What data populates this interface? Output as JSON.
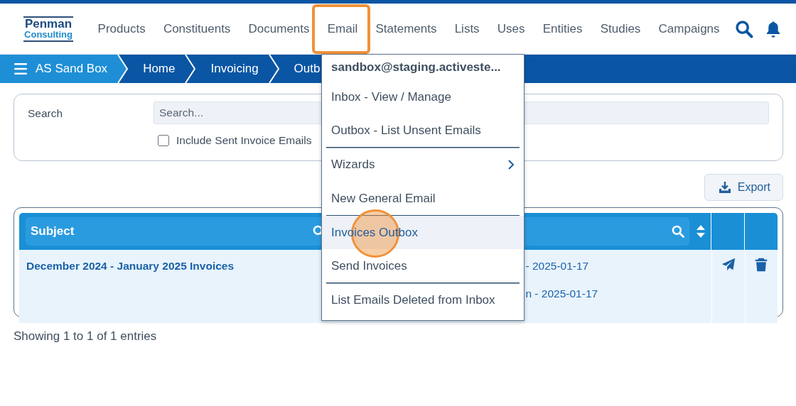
{
  "logo": {
    "line1": "Penman",
    "line2": "Consulting"
  },
  "nav": [
    {
      "label": "Products",
      "selected": false
    },
    {
      "label": "Constituents",
      "selected": false
    },
    {
      "label": "Documents",
      "selected": false
    },
    {
      "label": "Email",
      "selected": true
    },
    {
      "label": "Statements",
      "selected": false
    },
    {
      "label": "Lists",
      "selected": false
    },
    {
      "label": "Uses",
      "selected": false
    },
    {
      "label": "Entities",
      "selected": false
    },
    {
      "label": "Studies",
      "selected": false
    },
    {
      "label": "Campaigns",
      "selected": false
    }
  ],
  "breadcrumbs": [
    {
      "label": "AS Sand Box",
      "kind": "root"
    },
    {
      "label": "Home",
      "kind": "crumb"
    },
    {
      "label": "Invoicing",
      "kind": "crumb"
    },
    {
      "label": "Outb",
      "kind": "crumb"
    }
  ],
  "search": {
    "label": "Search",
    "placeholder": "Search...",
    "include_sent": {
      "label": "Include Sent Invoice Emails",
      "checked": false
    }
  },
  "export_button": "Export",
  "table": {
    "columns": [
      "Subject"
    ],
    "rows": [
      {
        "subject": "December 2024 - January 2025 Invoices",
        "column_2": [
          "- 2025-01-17",
          "n - 2025-01-17"
        ]
      }
    ]
  },
  "status": "Showing 1 to 1 of 1 entries",
  "menu": {
    "account": "sandbox@staging.activeste...",
    "items": [
      {
        "label": "Inbox - View / Manage",
        "selected": false,
        "submenu": false,
        "divider_after": false
      },
      {
        "label": "Outbox - List Unsent Emails",
        "selected": false,
        "submenu": false,
        "divider_after": true
      },
      {
        "label": "Wizards",
        "selected": false,
        "submenu": true,
        "divider_after": false
      },
      {
        "label": "New General Email",
        "selected": false,
        "submenu": false,
        "divider_after": true
      },
      {
        "label": "Invoices Outbox",
        "selected": true,
        "submenu": false,
        "divider_after": false
      },
      {
        "label": "Send Invoices",
        "selected": false,
        "submenu": false,
        "divider_after": true
      },
      {
        "label": "List Emails Deleted from Inbox",
        "selected": false,
        "submenu": false,
        "divider_after": false
      }
    ]
  }
}
